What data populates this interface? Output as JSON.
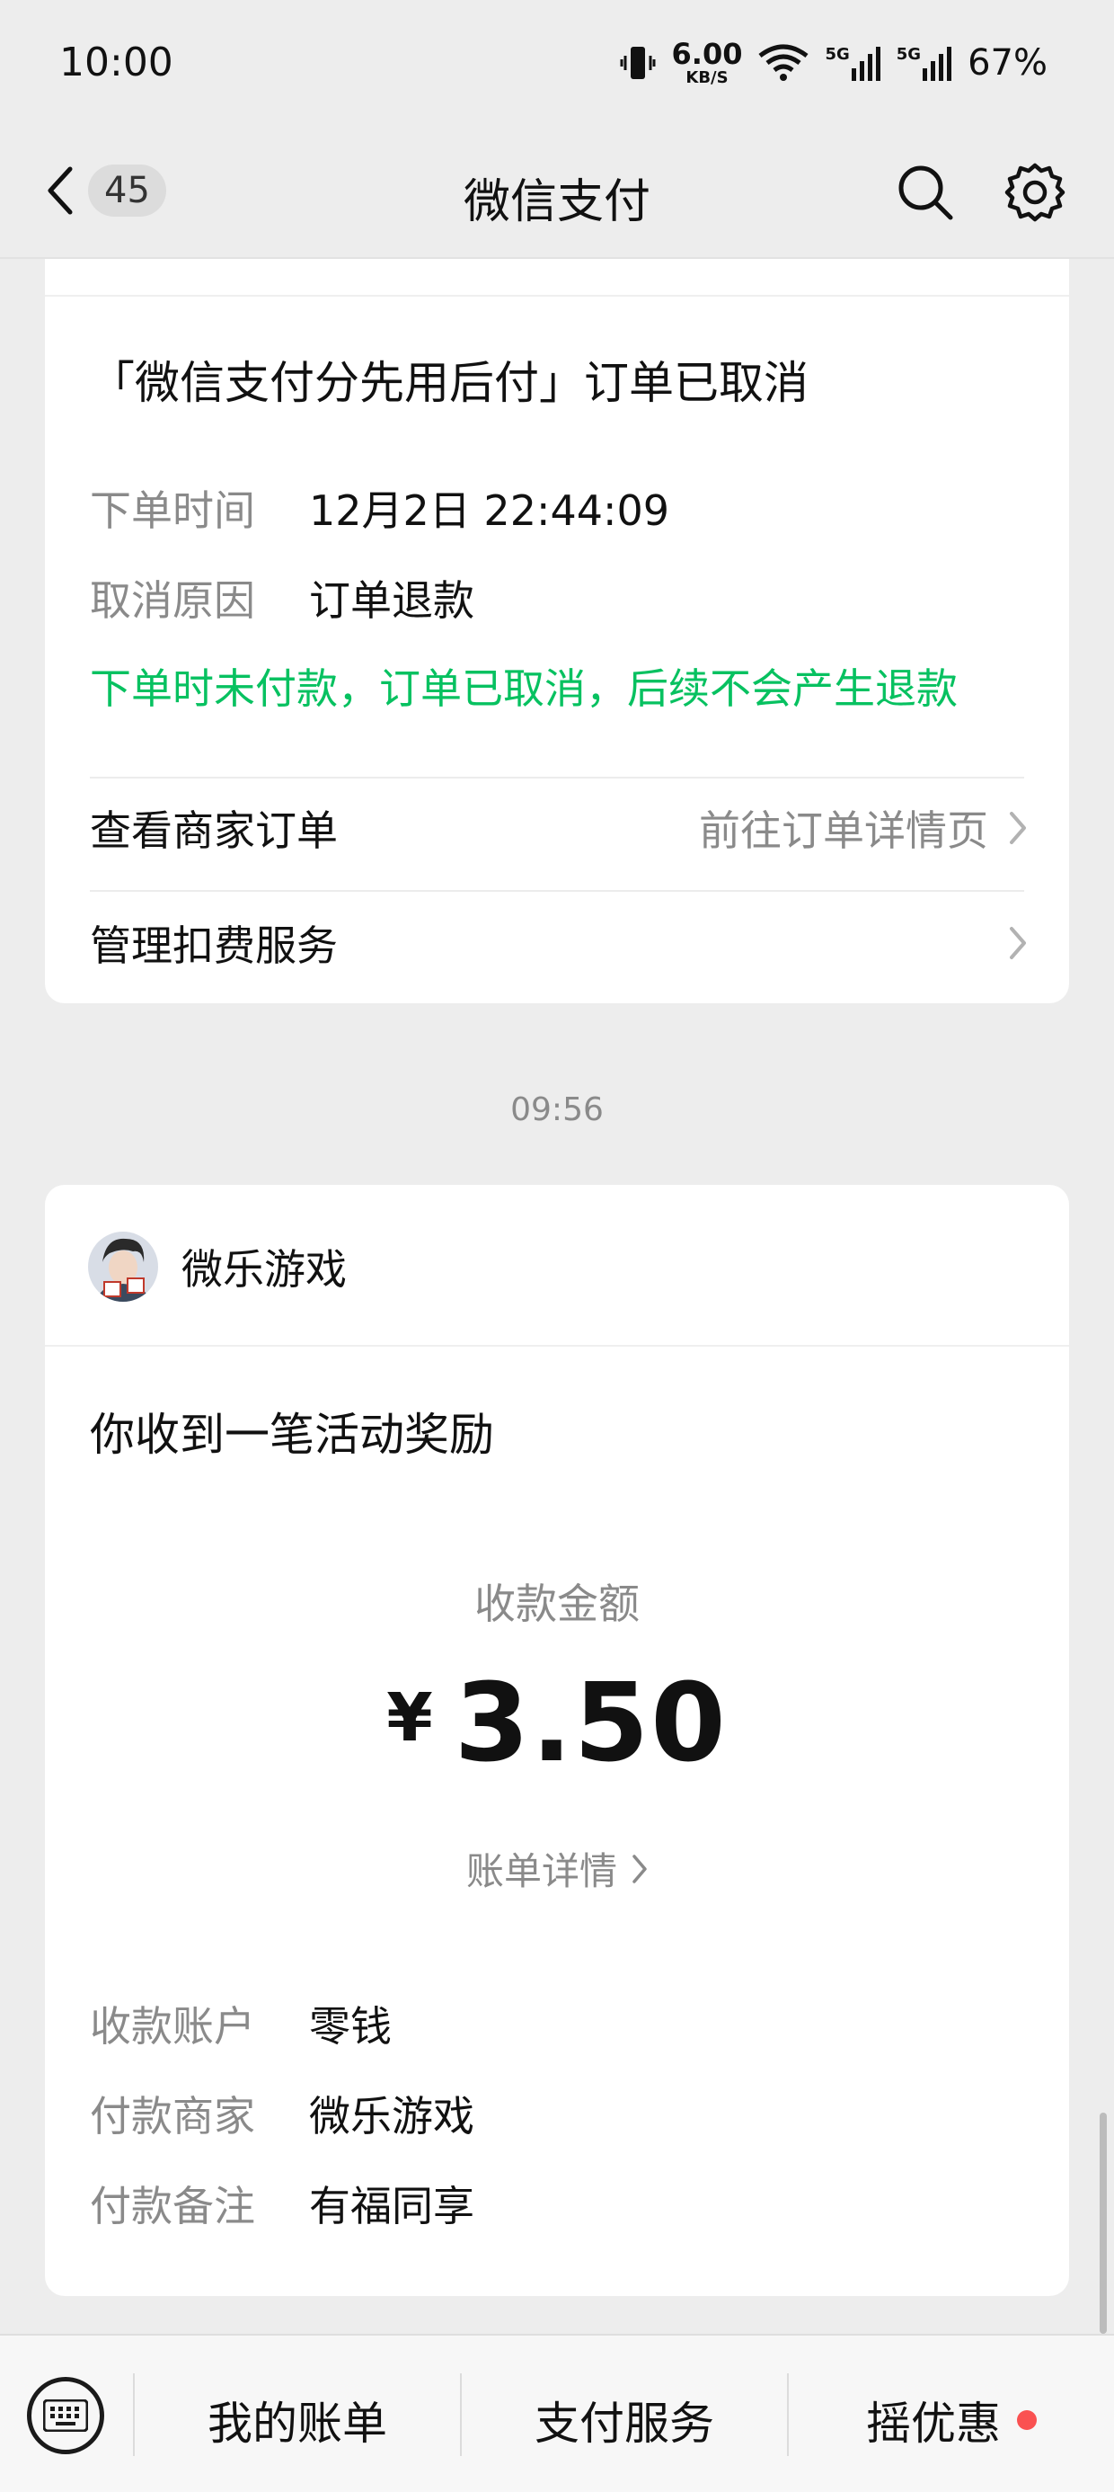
{
  "status": {
    "time": "10:00",
    "net_speed": "6.00",
    "net_unit": "KB/S",
    "sim1": "5G",
    "sim2": "5G",
    "battery": "67%"
  },
  "header": {
    "unread_count": "45",
    "title": "微信支付"
  },
  "order_card": {
    "title": "「微信支付分先用后付」订单已取消",
    "rows": [
      {
        "label": "下单时间",
        "value": "12月2日 22:44:09"
      },
      {
        "label": "取消原因",
        "value": "订单退款"
      }
    ],
    "note": "下单时未付款，订单已取消，后续不会产生退款",
    "note_color": "#07c160",
    "links": [
      {
        "label": "查看商家订单",
        "hint": "前往订单详情页"
      },
      {
        "label": "管理扣费服务",
        "hint": ""
      }
    ]
  },
  "time_separator": "09:56",
  "payment_card": {
    "merchant_name": "微乐游戏",
    "title": "你收到一笔活动奖励",
    "amount_label": "收款金额",
    "currency": "¥",
    "amount": "3.50",
    "bill_link": "账单详情",
    "rows": [
      {
        "label": "收款账户",
        "value": "零钱"
      },
      {
        "label": "付款商家",
        "value": "微乐游戏"
      },
      {
        "label": "付款备注",
        "value": "有福同享"
      }
    ]
  },
  "bottom_menu": {
    "items": [
      "我的账单",
      "支付服务",
      "摇优惠"
    ],
    "dot_color": "#fa5151"
  }
}
